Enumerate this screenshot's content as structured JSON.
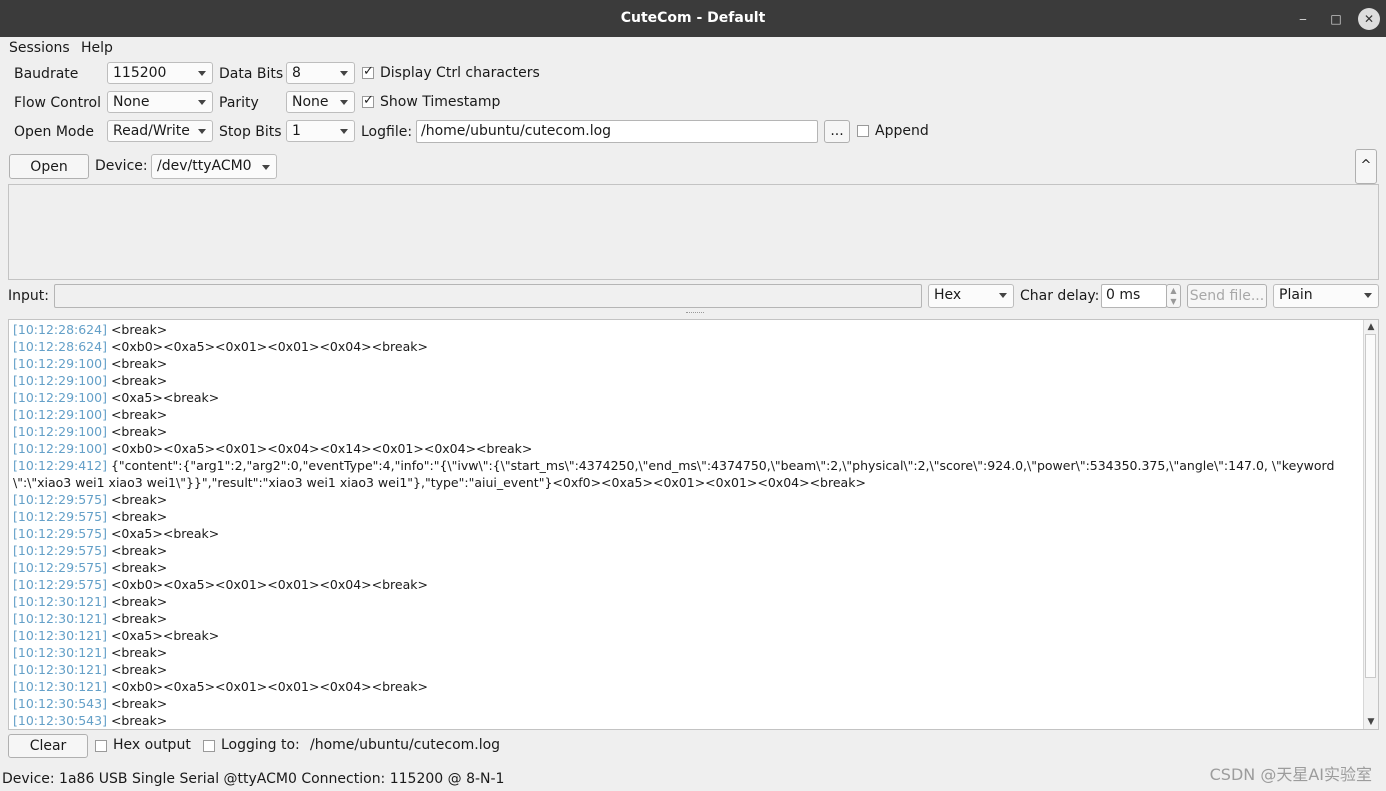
{
  "window": {
    "title": "CuteCom - Default",
    "minimize": "‒",
    "maximize": "□",
    "close": "✕"
  },
  "menu": {
    "sessions": "Sessions",
    "help": "Help"
  },
  "settings": {
    "baudrate_label": "Baudrate",
    "baudrate": "115200",
    "databits_label": "Data Bits",
    "databits": "8",
    "display_ctrl_label": "Display Ctrl characters",
    "display_ctrl_checked": true,
    "flow_label": "Flow Control",
    "flow": "None",
    "parity_label": "Parity",
    "parity": "None",
    "timestamp_label": "Show Timestamp",
    "timestamp_checked": true,
    "openmode_label": "Open Mode",
    "openmode": "Read/Write",
    "stopbits_label": "Stop Bits",
    "stopbits": "1",
    "logfile_label": "Logfile:",
    "logfile": "/home/ubuntu/cutecom.log",
    "browse_label": "...",
    "append_label": "Append",
    "append_checked": false
  },
  "device": {
    "open_label": "Open",
    "device_label": "Device:",
    "device": "/dev/ttyACM0",
    "collapse_icon": "^"
  },
  "input": {
    "label": "Input:",
    "value": "",
    "format": "Hex",
    "chardelay_label": "Char delay:",
    "chardelay": "0 ms",
    "sendfile_label": "Send file...",
    "mode": "Plain"
  },
  "output": {
    "lines": [
      {
        "ts": "[10:12:28:624]",
        "text": "<break>"
      },
      {
        "ts": "[10:12:28:624]",
        "text": "<0xb0><0xa5><0x01><0x01><0x04><break>"
      },
      {
        "ts": "[10:12:29:100]",
        "text": "<break>"
      },
      {
        "ts": "[10:12:29:100]",
        "text": "<break>"
      },
      {
        "ts": "[10:12:29:100]",
        "text": "<0xa5><break>"
      },
      {
        "ts": "[10:12:29:100]",
        "text": "<break>"
      },
      {
        "ts": "[10:12:29:100]",
        "text": "<break>"
      },
      {
        "ts": "[10:12:29:100]",
        "text": "<0xb0><0xa5><0x01><0x04><0x14><0x01><0x04><break>"
      },
      {
        "ts": "[10:12:29:412]",
        "text": "{\"content\":{\"arg1\":2,\"arg2\":0,\"eventType\":4,\"info\":\"{\\\"ivw\\\":{\\\"start_ms\\\":4374250,\\\"end_ms\\\":4374750,\\\"beam\\\":2,\\\"physical\\\":2,\\\"score\\\":924.0,\\\"power\\\":534350.375,\\\"angle\\\":147.0, \\\"keyword\\\":\\\"xiao3 wei1 xiao3 wei1\\\"}}\",\"result\":\"xiao3 wei1 xiao3 wei1\"},\"type\":\"aiui_event\"}<0xf0><0xa5><0x01><0x01><0x04><break>"
      },
      {
        "ts": "[10:12:29:575]",
        "text": "<break>"
      },
      {
        "ts": "[10:12:29:575]",
        "text": "<break>"
      },
      {
        "ts": "[10:12:29:575]",
        "text": "<0xa5><break>"
      },
      {
        "ts": "[10:12:29:575]",
        "text": "<break>"
      },
      {
        "ts": "[10:12:29:575]",
        "text": "<break>"
      },
      {
        "ts": "[10:12:29:575]",
        "text": "<0xb0><0xa5><0x01><0x01><0x04><break>"
      },
      {
        "ts": "[10:12:30:121]",
        "text": "<break>"
      },
      {
        "ts": "[10:12:30:121]",
        "text": "<break>"
      },
      {
        "ts": "[10:12:30:121]",
        "text": "<0xa5><break>"
      },
      {
        "ts": "[10:12:30:121]",
        "text": "<break>"
      },
      {
        "ts": "[10:12:30:121]",
        "text": "<break>"
      },
      {
        "ts": "[10:12:30:121]",
        "text": "<0xb0><0xa5><0x01><0x01><0x04><break>"
      },
      {
        "ts": "[10:12:30:543]",
        "text": "<break>"
      },
      {
        "ts": "[10:12:30:543]",
        "text": "<break>"
      }
    ]
  },
  "bottom": {
    "clear_label": "Clear",
    "hexoutput_label": "Hex output",
    "hexoutput_checked": false,
    "logging_label": "Logging to:",
    "logging_checked": false,
    "logging_path": "/home/ubuntu/cutecom.log"
  },
  "status": {
    "device": "Device:  1a86 USB Single Serial @ttyACM0  Connection:  115200 @ 8-N-1"
  },
  "watermark": "CSDN @天星AI实验室"
}
